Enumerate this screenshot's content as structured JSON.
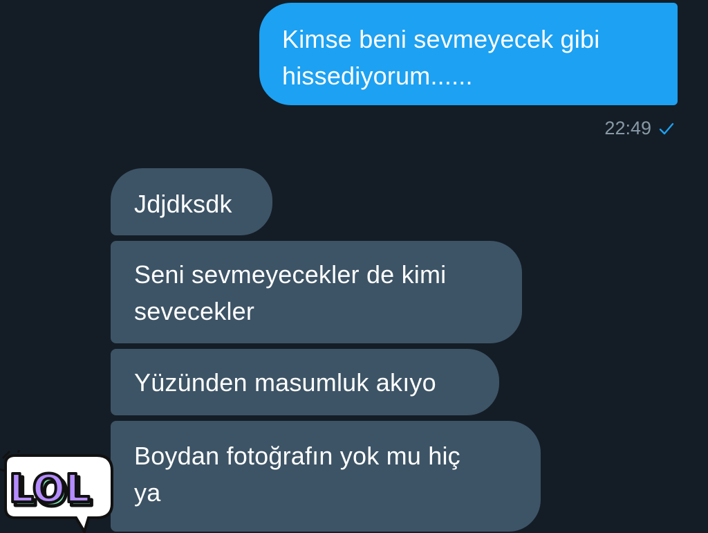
{
  "chat": {
    "sent_message": {
      "text": "Kimse beni sevmeyecek gibi\nhissediyorum......",
      "time": "22:49",
      "status_icon": "check-icon"
    },
    "received_messages": [
      {
        "text": "Jdjdksdk"
      },
      {
        "text": "Seni sevmeyecekler de kimi\nsevecekler"
      },
      {
        "text": "Yüzünden masumluk akıyo"
      },
      {
        "text": "Boydan fotoğrafın yok mu hiç\nya"
      }
    ]
  },
  "watermark": {
    "text": "LOL",
    "icon": "lol-speech-bubble-logo",
    "colors": {
      "fill": "#b58cff",
      "shadow": "#7ee0b0",
      "outline": "#111111",
      "bubble": "#ffffff"
    }
  },
  "colors": {
    "background": "#141d26",
    "sent_bubble": "#1da1f2",
    "received_bubble": "#3d5466",
    "timestamp": "#8899a6"
  }
}
